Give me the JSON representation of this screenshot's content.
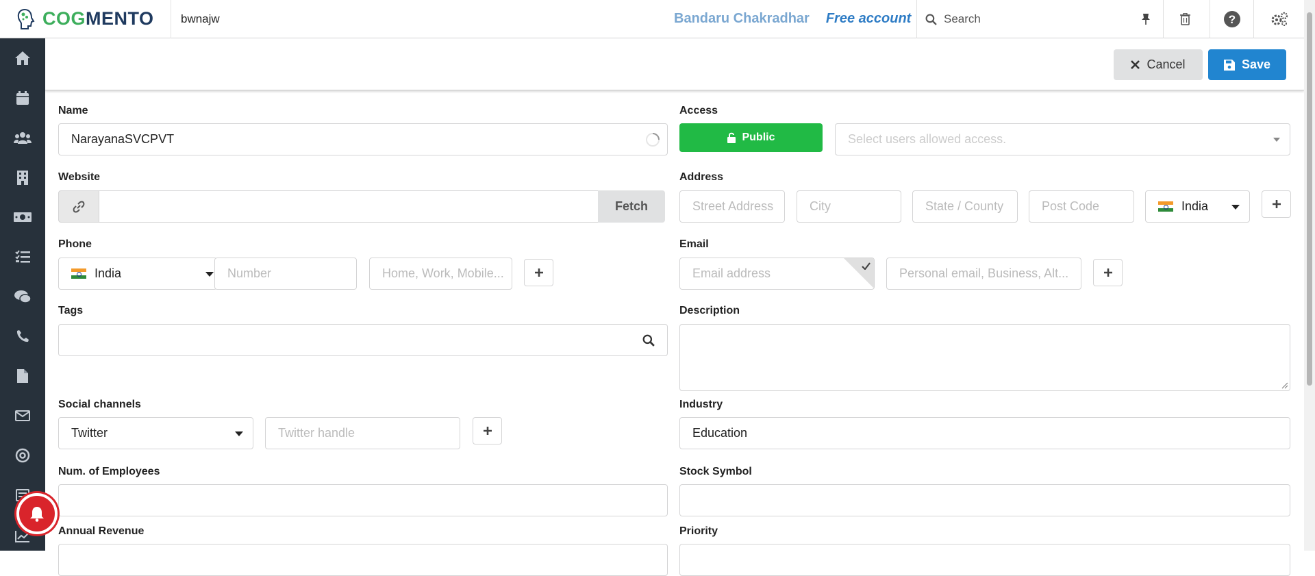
{
  "brand": {
    "logo_part1": "COG",
    "logo_part2": "MENTO"
  },
  "header": {
    "record_title": "bwnajw",
    "user_name": "Bandaru Chakradhar",
    "account_type": "Free account",
    "search_placeholder": "Search"
  },
  "sidebar": {
    "items": [
      "home-icon",
      "calendar-icon",
      "contacts-icon",
      "companies-icon",
      "deals-icon",
      "tasks-icon",
      "cases-icon",
      "calls-icon",
      "documents-icon",
      "email-icon",
      "campaigns-icon",
      "forms-icon",
      "reports-icon"
    ]
  },
  "actions": {
    "cancel_label": "Cancel",
    "save_label": "Save"
  },
  "form": {
    "name": {
      "label": "Name",
      "value": "NarayanaSVCPVT"
    },
    "access": {
      "label": "Access",
      "button_label": "Public",
      "users_placeholder": "Select users allowed access."
    },
    "website": {
      "label": "Website",
      "value": "",
      "fetch_label": "Fetch"
    },
    "address": {
      "label": "Address",
      "street_placeholder": "Street Address",
      "city_placeholder": "City",
      "state_placeholder": "State / County",
      "postcode_placeholder": "Post Code",
      "country": "India"
    },
    "phone": {
      "label": "Phone",
      "country": "India",
      "number_placeholder": "Number",
      "type_placeholder": "Home, Work, Mobile..."
    },
    "email": {
      "label": "Email",
      "address_placeholder": "Email address",
      "type_placeholder": "Personal email, Business, Alt..."
    },
    "tags": {
      "label": "Tags",
      "value": ""
    },
    "description": {
      "label": "Description",
      "value": ""
    },
    "social": {
      "label": "Social channels",
      "channel": "Twitter",
      "handle_placeholder": "Twitter handle"
    },
    "industry": {
      "label": "Industry",
      "value": "Education"
    },
    "employees": {
      "label": "Num. of Employees",
      "value": ""
    },
    "stock": {
      "label": "Stock Symbol",
      "value": ""
    },
    "revenue": {
      "label": "Annual Revenue"
    },
    "priority": {
      "label": "Priority"
    }
  },
  "colors": {
    "public_green": "#21ba45",
    "save_blue": "#2185d0",
    "sidebar_bg": "#27313b",
    "notif_red": "#d9242b"
  }
}
